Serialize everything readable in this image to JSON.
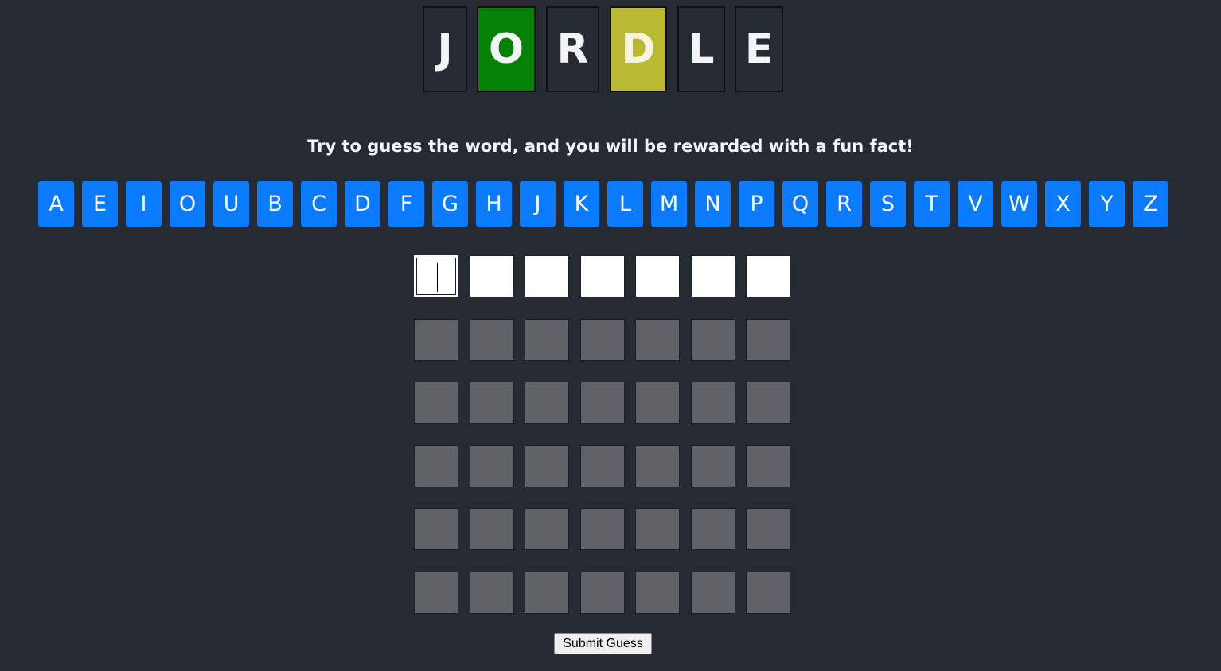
{
  "title": {
    "letters": [
      {
        "char": "J",
        "state": "default"
      },
      {
        "char": "O",
        "state": "correct"
      },
      {
        "char": "R",
        "state": "default"
      },
      {
        "char": "D",
        "state": "present"
      },
      {
        "char": "L",
        "state": "default"
      },
      {
        "char": "E",
        "state": "default"
      }
    ]
  },
  "subtitle": "Try to guess the word, and you will be rewarded with a fun fact!",
  "keyboard": {
    "keys": [
      "A",
      "E",
      "I",
      "O",
      "U",
      "B",
      "C",
      "D",
      "F",
      "G",
      "H",
      "J",
      "K",
      "L",
      "M",
      "N",
      "P",
      "Q",
      "R",
      "S",
      "T",
      "V",
      "W",
      "X",
      "Y",
      "Z"
    ]
  },
  "grid": {
    "rows": 6,
    "cols": 7,
    "active_row": 0,
    "focused_col": 0,
    "rows_values": [
      [
        "",
        "",
        "",
        "",
        "",
        "",
        ""
      ],
      [
        "",
        "",
        "",
        "",
        "",
        "",
        ""
      ],
      [
        "",
        "",
        "",
        "",
        "",
        "",
        ""
      ],
      [
        "",
        "",
        "",
        "",
        "",
        "",
        ""
      ],
      [
        "",
        "",
        "",
        "",
        "",
        "",
        ""
      ],
      [
        "",
        "",
        "",
        "",
        "",
        "",
        ""
      ]
    ]
  },
  "submit_label": "Submit Guess",
  "colors": {
    "background": "#262a33",
    "correct": "#058205",
    "present": "#b9b933",
    "key": "#0a7bff",
    "empty_cell": "#5f6266",
    "active_cell": "#ffffff"
  }
}
